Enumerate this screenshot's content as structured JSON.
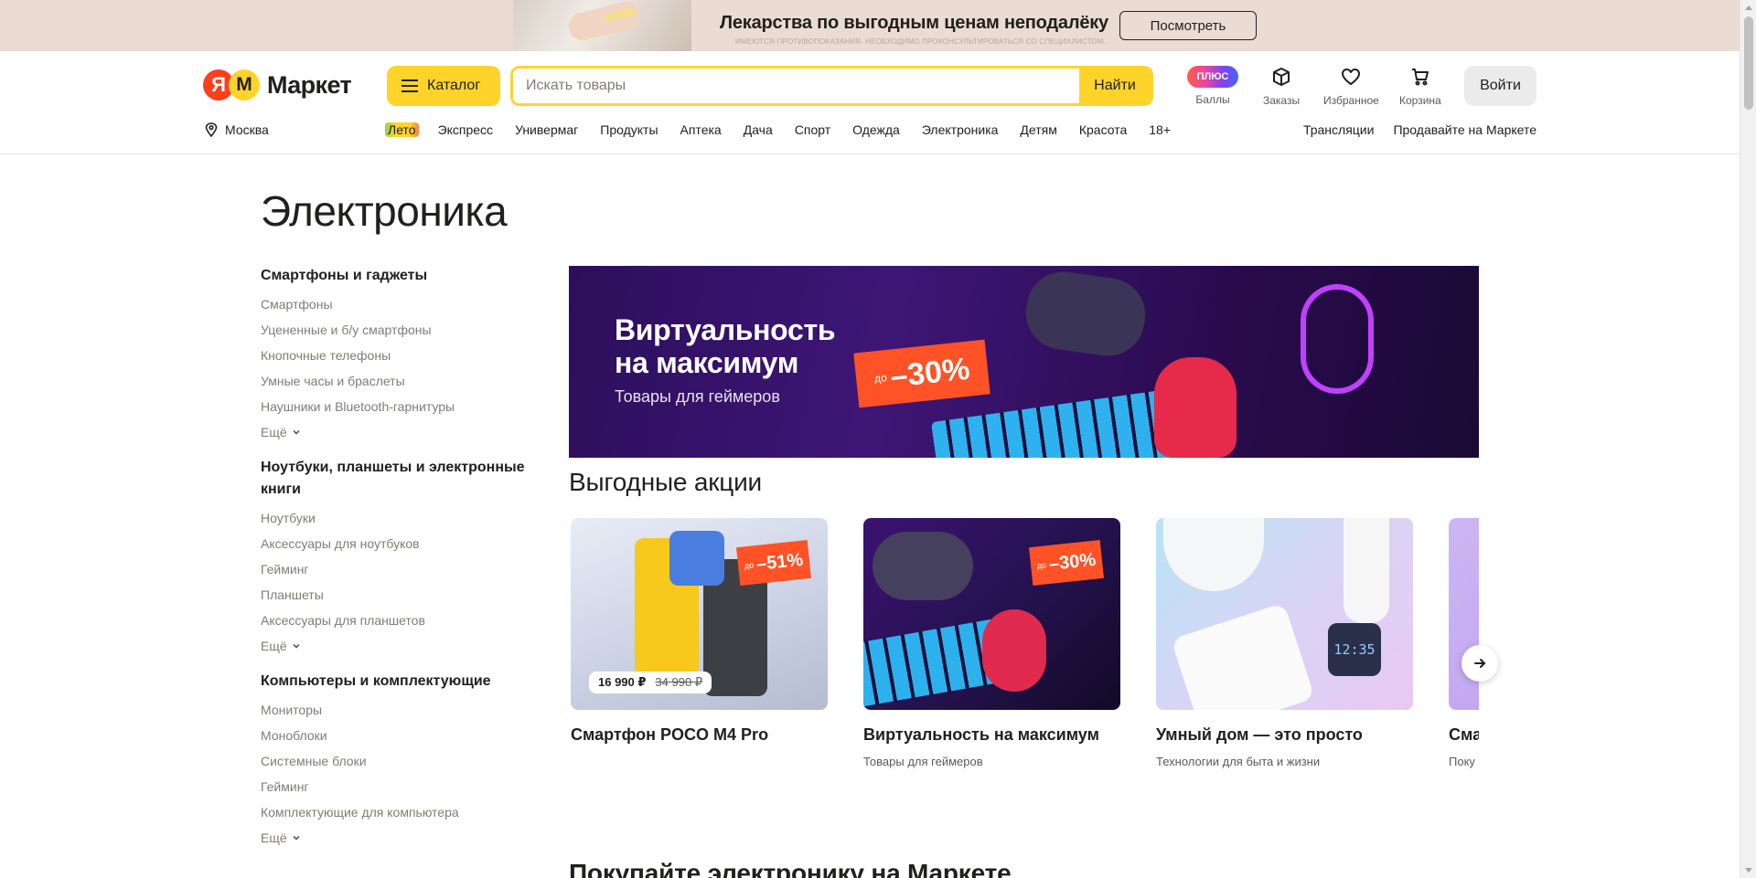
{
  "promo": {
    "title": "Лекарства по выгодным ценам неподалёку",
    "note": "ИМЕЮТСЯ ПРОТИВОПОКАЗАНИЯ. НЕОБХОДИМО ПРОКОНСУЛЬТИРОВАТЬСЯ СО СПЕЦИАЛИСТОМ.",
    "button": "Посмотреть"
  },
  "header": {
    "logo_letter": "Я",
    "logo_m": "M",
    "logo_text": "Маркет",
    "catalog_label": "Каталог",
    "search_placeholder": "Искать товары",
    "search_button": "Найти",
    "plus_badge": "ПЛЮС",
    "icons": [
      {
        "label": "Баллы",
        "icon": "plus-points"
      },
      {
        "label": "Заказы",
        "icon": "box-icon"
      },
      {
        "label": "Избранное",
        "icon": "heart-icon"
      },
      {
        "label": "Корзина",
        "icon": "cart-icon"
      }
    ],
    "login": "Войти"
  },
  "nav": {
    "city": "Москва",
    "links": [
      "Лето",
      "Экспресс",
      "Универмаг",
      "Продукты",
      "Аптека",
      "Дача",
      "Спорт",
      "Одежда",
      "Электроника",
      "Детям",
      "Красота",
      "18+"
    ],
    "right": [
      "Трансляции",
      "Продавайте на Маркете"
    ]
  },
  "page": {
    "title": "Электроника"
  },
  "sidebar": {
    "groups": [
      {
        "title": "Смартфоны и гаджеты",
        "items": [
          "Смартфоны",
          "Уцененные и б/у смартфоны",
          "Кнопочные телефоны",
          "Умные часы и браслеты",
          "Наушники и Bluetooth-гарнитуры"
        ],
        "more": "Ещё"
      },
      {
        "title": "Ноутбуки, планшеты и электронные книги",
        "items": [
          "Ноутбуки",
          "Аксессуары для ноутбуков",
          "Гейминг",
          "Планшеты",
          "Аксессуары для планшетов"
        ],
        "more": "Ещё"
      },
      {
        "title": "Компьютеры и комплектующие",
        "items": [
          "Мониторы",
          "Моноблоки",
          "Системные блоки",
          "Гейминг",
          "Комплектующие для компьютера"
        ],
        "more": "Ещё"
      }
    ]
  },
  "hero": {
    "title_line1": "Виртуальность",
    "title_line2": "на максимум",
    "subtitle": "Товары для геймеров",
    "badge_pre": "до",
    "badge_pct": "–30%"
  },
  "promos_section": {
    "title": "Выгодные акции",
    "cards": [
      {
        "title": "Смартфон POCO M4 Pro",
        "subtitle": "",
        "badge_pre": "до",
        "badge_pct": "–51%",
        "price_now": "16 990 ₽",
        "price_old": "34 990 ₽"
      },
      {
        "title": "Виртуальность на максимум",
        "subtitle": "Товары для геймеров",
        "badge_pre": "до",
        "badge_pct": "–30%"
      },
      {
        "title": "Умный дом — это просто",
        "subtitle": "Технологии для быта и жизни",
        "watch_time": "12:35"
      },
      {
        "title": "Сма",
        "subtitle": "Поку"
      }
    ]
  },
  "section2": {
    "title": "Покупайте электронику на Маркете"
  },
  "colors": {
    "brand_yellow": "#fed42b",
    "brand_red": "#fc3f1d",
    "promo_bg": "#eadcd2",
    "discount": "#ff5226"
  }
}
